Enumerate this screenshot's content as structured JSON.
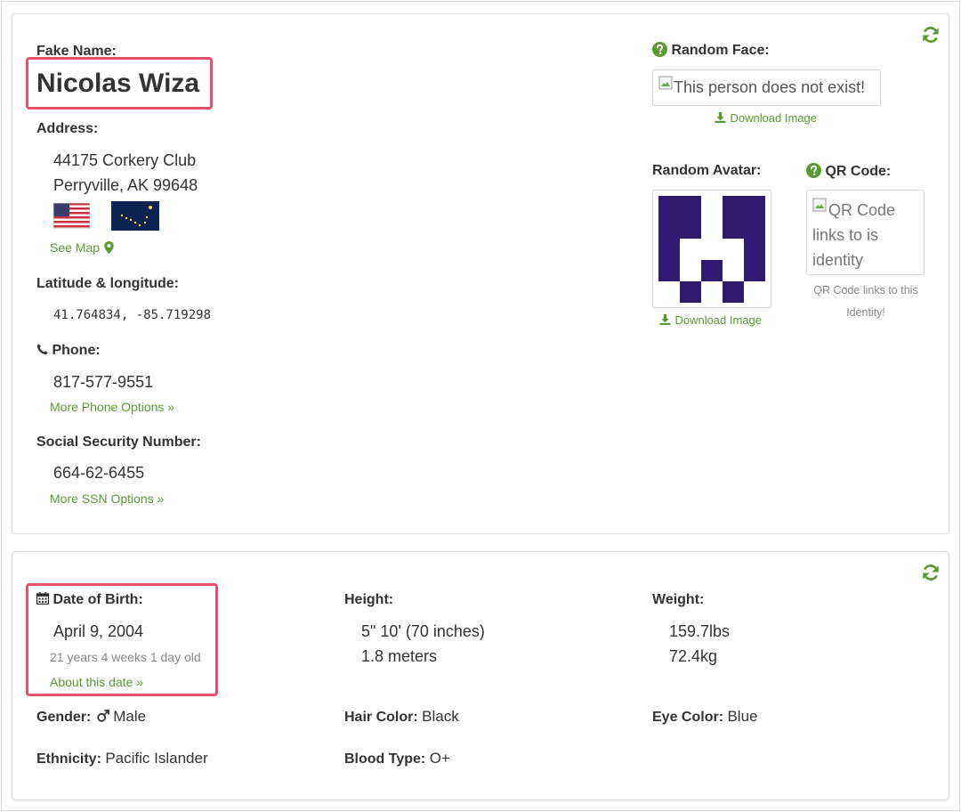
{
  "identity": {
    "name_label": "Fake Name:",
    "name": "Nicolas Wiza",
    "address_label": "Address:",
    "address_line1": "44175 Corkery Club",
    "address_line2": "Perryville, AK 99648",
    "see_map": "See Map",
    "latlong_label": "Latitude & longitude:",
    "latlong": "41.764834, -85.719298",
    "phone_label": "Phone:",
    "phone": "817-577-9551",
    "more_phone": "More Phone Options »",
    "ssn_label": "Social Security Number:",
    "ssn": "664-62-6455",
    "more_ssn": "More SSN Options »"
  },
  "media": {
    "face_label": "Random Face:",
    "face_alt": "This person does not exist!",
    "download_image": "Download Image",
    "avatar_label": "Random Avatar:",
    "qr_label": "QR Code:",
    "qr_alt": "QR Code links to is identity",
    "qr_caption": "QR Code links to this Identity!"
  },
  "details": {
    "dob_label": "Date of Birth:",
    "dob": "April 9, 2004",
    "age": "21 years 4 weeks 1 day old",
    "about_date": "About this date »",
    "height_label": "Height:",
    "height_imperial": "5\" 10' (70 inches)",
    "height_metric": "1.8 meters",
    "weight_label": "Weight:",
    "weight_imperial": "159.7lbs",
    "weight_metric": "72.4kg",
    "gender_label": "Gender:",
    "gender": "Male",
    "hair_label": "Hair Color:",
    "hair": "Black",
    "eye_label": "Eye Color:",
    "eye": "Blue",
    "ethnicity_label": "Ethnicity:",
    "ethnicity": "Pacific Islander",
    "blood_label": "Blood Type:",
    "blood": "O+"
  },
  "colors": {
    "accent_green": "#5a9a33",
    "highlight_red": "#e5516a",
    "avatar_purple": "#2e1a6e"
  },
  "icons": {
    "refresh": "refresh-icon",
    "help": "question-circle-icon",
    "phone": "phone-icon",
    "calendar": "calendar-icon",
    "map_marker": "map-marker-icon",
    "download": "download-icon",
    "male": "male-symbol-icon"
  }
}
